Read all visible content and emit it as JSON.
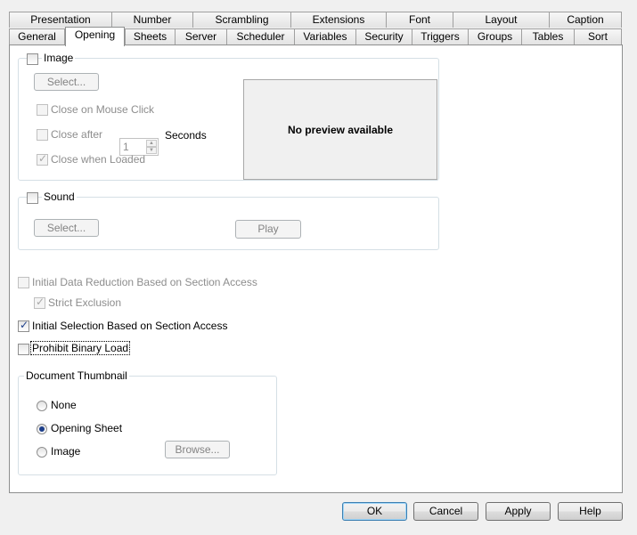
{
  "tabs_row1": [
    "Presentation",
    "Number",
    "Scrambling",
    "Extensions",
    "Font",
    "Layout",
    "Caption"
  ],
  "tabs_row2": [
    "General",
    "Opening",
    "Sheets",
    "Server",
    "Scheduler",
    "Variables",
    "Security",
    "Triggers",
    "Groups",
    "Tables",
    "Sort"
  ],
  "active_tab": "Opening",
  "image_group": {
    "label": "Image",
    "select_button": "Select...",
    "close_on_mouse_click": "Close on Mouse Click",
    "close_after": "Close after",
    "close_after_value": "1",
    "seconds_label": "Seconds",
    "close_when_loaded": "Close when Loaded",
    "preview_text": "No preview available"
  },
  "sound_group": {
    "label": "Sound",
    "select_button": "Select...",
    "play_button": "Play"
  },
  "options": {
    "initial_data_reduction": "Initial Data Reduction Based on Section Access",
    "strict_exclusion": "Strict Exclusion",
    "initial_selection": "Initial Selection Based on Section Access",
    "prohibit_binary_load": "Prohibit Binary Load"
  },
  "thumbnail_group": {
    "label": "Document Thumbnail",
    "none": "None",
    "opening_sheet": "Opening Sheet",
    "image": "Image",
    "selected": "Opening Sheet",
    "browse_button": "Browse..."
  },
  "footer": {
    "ok": "OK",
    "cancel": "Cancel",
    "apply": "Apply",
    "help": "Help"
  }
}
